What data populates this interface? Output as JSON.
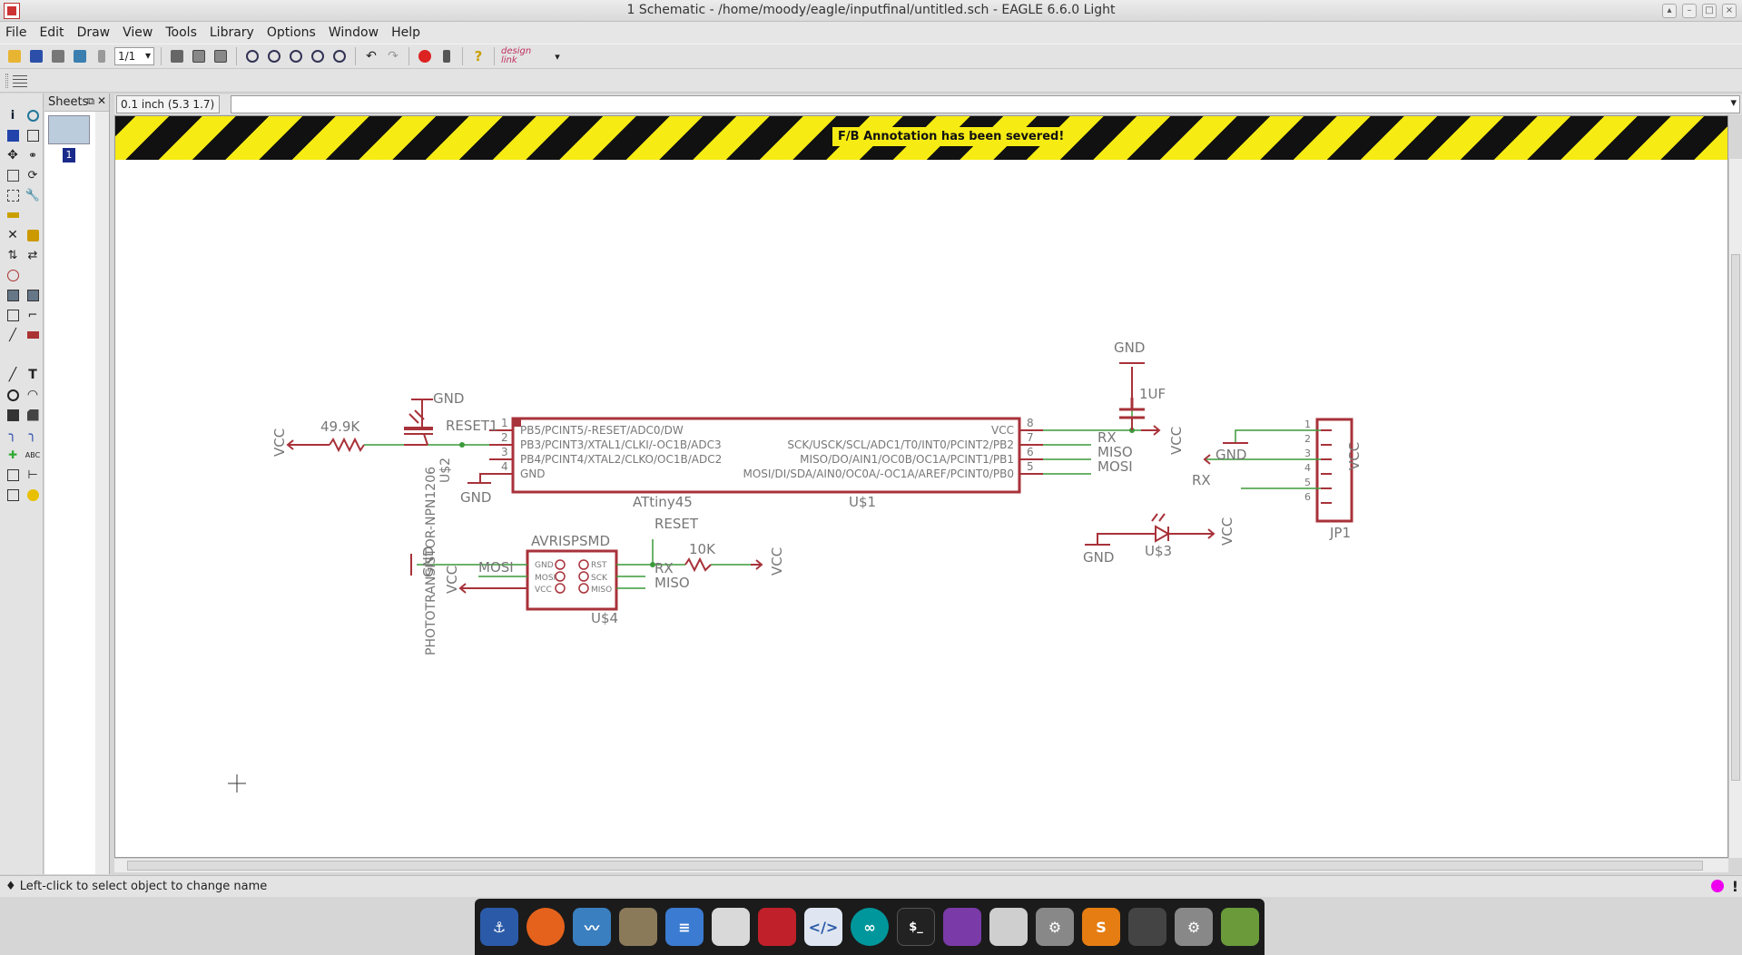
{
  "window": {
    "title": "1 Schematic - /home/moody/eagle/inputfinal/untitled.sch - EAGLE 6.6.0 Light"
  },
  "menu": [
    "File",
    "Edit",
    "Draw",
    "View",
    "Tools",
    "Library",
    "Options",
    "Window",
    "Help"
  ],
  "toolbar": {
    "sheet_value": "1/1",
    "design_link_text": "design link",
    "icons": [
      "open-icon",
      "save-icon",
      "print-icon",
      "cam-icon",
      "sheet-select",
      "board-icon",
      "script-icon",
      "run-ulp-icon",
      "zoom-fit-icon",
      "zoom-in-icon",
      "zoom-out-icon",
      "zoom-redraw-icon",
      "zoom-select-icon",
      "undo-icon",
      "redo-icon",
      "stop-icon",
      "go-icon",
      "help-icon",
      "design-link-icon"
    ]
  },
  "sheets_panel": {
    "title": "Sheets",
    "sheet_number": "1"
  },
  "coordinate": "0.1 inch (5.3 1.7)",
  "command_line": {
    "value": ""
  },
  "banner": "F/B Annotation has been severed!",
  "status": {
    "message": "♦ Left-click to select object to change name"
  },
  "colors": {
    "hazard_yellow": "#f6eb13",
    "hazard_black": "#111111",
    "symbol": "#a8323a",
    "net": "#3a9a3a",
    "text": "#777777"
  },
  "schematic": {
    "u1": {
      "name": "U$1",
      "value": "ATtiny45",
      "left_pins": [
        {
          "num": "1",
          "name": "PB5/PCINT5/-RESET/ADC0/DW"
        },
        {
          "num": "2",
          "name": "PB3/PCINT3/XTAL1/CLKI/-OC1B/ADC3"
        },
        {
          "num": "3",
          "name": "PB4/PCINT4/XTAL2/CLKO/OC1B/ADC2"
        },
        {
          "num": "4",
          "name": "GND"
        }
      ],
      "right_pins": [
        {
          "num": "8",
          "name": "VCC"
        },
        {
          "num": "7",
          "name": "SCK/USCK/SCL/ADC1/T0/INT0/PCINT2/PB2"
        },
        {
          "num": "6",
          "name": "MISO/DO/AIN1/OC0B/OC1A/PCINT1/PB1"
        },
        {
          "num": "5",
          "name": "MOSI/DI/SDA/AIN0/OC0A/-OC1A/AREF/PCINT0/PB0"
        }
      ]
    },
    "labels": {
      "vcc": "VCC",
      "gnd": "GND",
      "rx": "RX",
      "miso": "MISO",
      "mosi": "MOSI",
      "reset": "RESET",
      "reset1": "RESET1",
      "r1": "49.9K",
      "r2": "10K",
      "cap": "1UF",
      "u2": "U$2",
      "u2_value": "PHOTOTRANSISTOR-NPN1206",
      "u3": "U$3",
      "u4": "U$4",
      "u4_value": "AVRISPSMD",
      "isp_gnd": "GND",
      "isp_mosi": "MOSI",
      "isp_vcc": "VCC",
      "isp_rst": "RST",
      "isp_sck": "SCK",
      "isp_miso": "MISO",
      "jp1": "JP1"
    },
    "jp1_pins": [
      "1",
      "2",
      "3",
      "4",
      "5",
      "6"
    ]
  },
  "dock": [
    "anchor-icon",
    "firefox-icon",
    "monitor-icon",
    "gimp-icon",
    "text-editor-icon",
    "store-icon",
    "eagle-icon",
    "code-icon",
    "arduino-icon",
    "terminal-icon",
    "video-icon",
    "camera-icon",
    "settings-icon",
    "sublime-icon",
    "calculator-icon",
    "system-settings-icon",
    "image-viewer-icon"
  ]
}
